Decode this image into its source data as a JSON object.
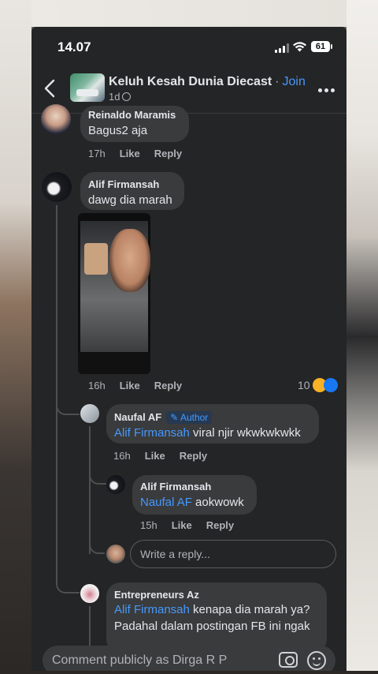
{
  "status_bar": {
    "time": "14.07",
    "battery": "61"
  },
  "header": {
    "group_name": "Keluh Kesah Dunia Diecast",
    "separator": "·",
    "join_label": "Join",
    "post_age": "1d"
  },
  "comments": [
    {
      "author": "Reinaldo Maramis",
      "text": "Bagus2 aja",
      "time": "17h",
      "like": "Like",
      "reply": "Reply"
    },
    {
      "author": "Alif Firmansah",
      "text": "dawg dia marah",
      "time": "16h",
      "like": "Like",
      "reply": "Reply",
      "reaction_count": "10"
    },
    {
      "author": "Naufal AF",
      "badge": "Author",
      "mention": "Alif Firmansah",
      "text": "viral njir wkwkwkwkk",
      "time": "16h",
      "like": "Like",
      "reply": "Reply"
    },
    {
      "author": "Alif Firmansah",
      "mention": "Naufal AF",
      "text": "aokwowk",
      "time": "15h",
      "like": "Like",
      "reply": "Reply"
    },
    {
      "author": "Entrepreneurs Az",
      "mention": "Alif Firmansah",
      "text_line1": "kenapa dia marah ya?",
      "text_line2": "Padahal dalam postingan FB ini ngak"
    }
  ],
  "reply_box": {
    "placeholder": "Write a reply..."
  },
  "composer": {
    "placeholder": "Comment publicly as Dirga R P"
  },
  "colors": {
    "background": "#242526",
    "bubble": "#3a3b3c",
    "link": "#4599ff",
    "secondary_text": "#b0b3b8"
  }
}
